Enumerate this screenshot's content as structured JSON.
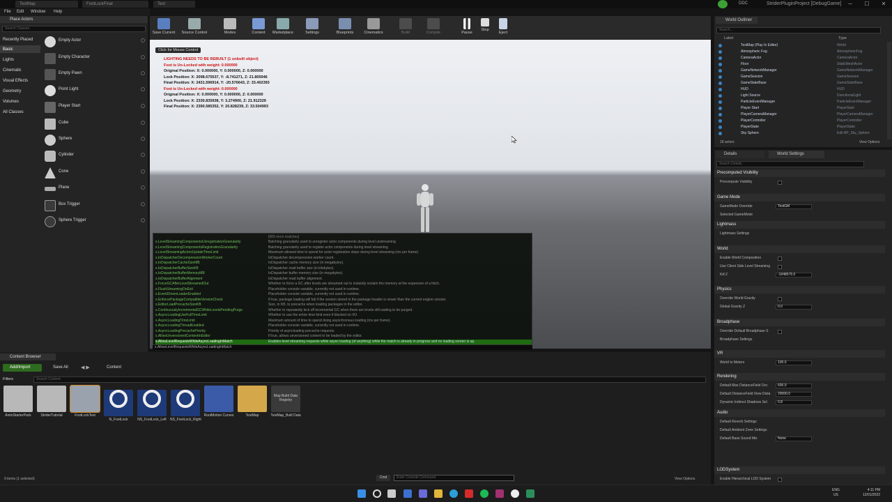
{
  "titlebar": {
    "tabs": [
      "TestMap",
      "FootLockFinal",
      "Test"
    ],
    "project": "StriderPluginProject [DebugGame]",
    "controls": [
      "─",
      "☐",
      "✕"
    ]
  },
  "menu": [
    "File",
    "Edit",
    "Window",
    "Help"
  ],
  "place_actors": {
    "tab": "Place Actors",
    "search_placeholder": "Search Classes",
    "categories": [
      "Recently Placed",
      "Basic",
      "Lights",
      "Cinematic",
      "Visual Effects",
      "Geometry",
      "Volumes",
      "All Classes"
    ],
    "items": [
      "Empty Actor",
      "Empty Character",
      "Empty Pawn",
      "Point Light",
      "Player Start",
      "Cube",
      "Sphere",
      "Cylinder",
      "Cone",
      "Plane",
      "Box Trigger",
      "Sphere Trigger"
    ]
  },
  "toolbar": [
    "Save Current",
    "Source Control",
    "Modes",
    "Content",
    "Marketplace",
    "Settings",
    "Blueprints",
    "Cinematics",
    "Build",
    "Compile",
    "Pause",
    "Stop",
    "Eject"
  ],
  "viewport": {
    "click_hint": "Click for Mouse Control",
    "lines": [
      {
        "text": "LIGHTING NEEDS TO BE REBUILT (1 unbuilt object)",
        "color": "#d01010"
      },
      {
        "text": "Foot is Un-Locked with weight: 0.000000",
        "color": "#d01010"
      },
      {
        "text": "Original Position: X: 0.000000, Y: 0.000000, Z: 0.000000",
        "color": "#111111"
      },
      {
        "text": "Lock Position: X: 2098.675537, Y: -8.741271, Z: 21.805946",
        "color": "#111111"
      },
      {
        "text": "Final Position: X: 2431.596914, Y: -20.576643, Z: 33.402393",
        "color": "#111111"
      },
      {
        "text": "Foot is Un-Locked with weight: 0.000000",
        "color": "#d01010"
      },
      {
        "text": "Original Position: X: 0.000000, Y: 0.000000, Z: 0.000000",
        "color": "#111111"
      },
      {
        "text": "Lock Position: X: 2330.835938, Y: 3.274900, Z: 21.912329",
        "color": "#111111"
      },
      {
        "text": "Final Position: X: 2390.585352, Y: 20.828239, Z: 33.504993",
        "color": "#111111"
      }
    ],
    "console": {
      "header": "[805 more matches]",
      "rows": [
        {
          "k": "s.LevelStreamingComponentsUnregistrationGranularity",
          "v": "Batching granularity used to unregister actor components during level unstreaming."
        },
        {
          "k": "s.LevelStreamingComponentsRegistrationGranularity",
          "v": "Batching granularity used to register actor components during level streaming."
        },
        {
          "k": "s.LevelStreamingActorsUpdateTimeLimit",
          "v": "Maximum allowed time to spend for actor registration steps during level streaming (ms per frame)."
        },
        {
          "k": "s.IoDispatcherDecompressionWorkerCount",
          "v": "IoDispatcher decompression worker count."
        },
        {
          "k": "s.IoDispatcherCacheSizeMB",
          "v": "IoDispatcher cache memory size (in megabytes)."
        },
        {
          "k": "s.IoDispatcherBufferSizeKB",
          "v": "IoDispatcher read buffer size (in kilobytes)."
        },
        {
          "k": "s.IoDispatcherBufferMemoryMB",
          "v": "IoDispatcher buffer memory size (in megabytes)."
        },
        {
          "k": "s.IoDispatcherBufferAlignment",
          "v": "IoDispatcher read buffer alignment."
        },
        {
          "k": "s.ForceGCAfterLevelStreamedOut",
          "v": "Whether to force a GC after levels are streamed out to instantly reclaim the memory at the expensive of a hitch."
        },
        {
          "k": "s.FlushStreamingOnExit",
          "v": "Placeholder console variable, currently not used in runtime."
        },
        {
          "k": "s.EventDrivenLoaderEnabled",
          "v": "Placeholder console variable, currently not used in runtime."
        },
        {
          "k": "s.EnforcePackageCompatibleVersionCheck",
          "v": "If true, package loading will fail if the version stored in the package header is newer than the current engine version."
        },
        {
          "k": "s.EditorLoadPrecacheSizeKB",
          "v": "Size, in KB, to precache when loading packages in the editor."
        },
        {
          "k": "s.ContinuouslyIncrementalGCWhileLevelsPendingPurge",
          "v": "Whether to repeatedly kick off incremental GC when there are levels still waiting to be purged."
        },
        {
          "k": "s.AsyncLoadingUseFullTimeLimit",
          "v": "Whether to use the entire time limit even if blocked on I/O."
        },
        {
          "k": "s.AsyncLoadingTimeLimit",
          "v": "Maximum amount of time to spend doing asynchronous loading (ms per frame)."
        },
        {
          "k": "s.AsyncLoadingThreadEnabled",
          "v": "Placeholder console variable, currently not used in runtime."
        },
        {
          "k": "s.AsyncLoadingPrecachePriority",
          "v": "Priority of asyncloading precache requests."
        },
        {
          "k": "s.AllowUnversionedContentInEditor",
          "v": "If true, allows unversioned content to be loaded by the editor."
        },
        {
          "k": "s.AllowLevelRequestsWhileAsyncLoadingInMatch",
          "v": "Enables level streaming requests while async loading (of anything) while the match is already in progress and no loading screen is up."
        }
      ],
      "input": "s.AllowLevelRequestsWhileAsyncLoadingInMatch"
    }
  },
  "content_browser": {
    "tab": "Content Browser",
    "add_import": "Add/Import",
    "save_all": "Save All",
    "path": "Content",
    "filters": "Filters",
    "search_placeholder": "Search Content",
    "assets": [
      "AnimStarterPack",
      "StriderTutorial",
      "FootLockTest",
      "N_FootLock",
      "NS_FootLock_Left",
      "NS_FootLock_Right",
      "RootMotion Curves",
      "TestMap",
      "TestMap_Built Data"
    ],
    "registry_label": "Map Build Data Registry",
    "status": "9 items (1 selected)",
    "cmd": "Cmd",
    "console_placeholder": "Enter Console Command",
    "view_options": "View Options"
  },
  "outliner": {
    "tab": "World Outliner",
    "search_placeholder": "Search...",
    "col_label": "Label",
    "col_type": "Type",
    "rows": [
      {
        "n": "TestMap (Play In Editor)",
        "t": "World"
      },
      {
        "n": "Atmospheric Fog",
        "t": "AtmosphericFog"
      },
      {
        "n": "CameraActor",
        "t": "CameraActor"
      },
      {
        "n": "Floor",
        "t": "StaticMeshActor"
      },
      {
        "n": "GameNetworkManager",
        "t": "GameNetworkManager"
      },
      {
        "n": "GameSession",
        "t": "GameSession"
      },
      {
        "n": "GameStateBase",
        "t": "GameStateBase"
      },
      {
        "n": "HUD",
        "t": "HUD"
      },
      {
        "n": "Light Source",
        "t": "DirectionalLight"
      },
      {
        "n": "ParticleEventManager",
        "t": "ParticleEventManager"
      },
      {
        "n": "Player Start",
        "t": "PlayerStart"
      },
      {
        "n": "PlayerCameraManager",
        "t": "PlayerCameraManager"
      },
      {
        "n": "PlayerController",
        "t": "PlayerController"
      },
      {
        "n": "PlayerState",
        "t": "PlayerState"
      },
      {
        "n": "Sky Sphere",
        "t": "Edit BP_Sky_Sphere"
      }
    ],
    "count": "18 actors",
    "view_options": "View Options"
  },
  "details": {
    "tabs": [
      "Details",
      "World Settings"
    ],
    "search_placeholder": "Search Details",
    "sections": [
      {
        "title": "Precomputed Visibility",
        "props": [
          {
            "n": "Precompute Visibility",
            "chk": true
          }
        ]
      },
      {
        "title": "Game Mode",
        "props": [
          {
            "n": "GameMode Override",
            "v": "TestGM"
          },
          {
            "n": "Selected GameMode",
            "v": ""
          }
        ]
      },
      {
        "title": "Lightmass",
        "props": [
          {
            "n": "Lightmass Settings",
            "v": ""
          }
        ]
      },
      {
        "title": "World",
        "props": [
          {
            "n": "Enable World Composition",
            "chk": true
          },
          {
            "n": "Use Client Side Level Streaming",
            "chk": true
          },
          {
            "n": "Kill Z",
            "v": "-1048575.0"
          }
        ]
      },
      {
        "title": "Physics",
        "props": [
          {
            "n": "Override World Gravity",
            "chk": true
          },
          {
            "n": "Global Gravity Z",
            "v": "0.0"
          }
        ]
      },
      {
        "title": "Broadphase",
        "props": [
          {
            "n": "Override Default Broadphase S",
            "chk": true
          },
          {
            "n": "Broadphase Settings",
            "v": ""
          }
        ]
      },
      {
        "title": "VR",
        "props": [
          {
            "n": "World to Meters",
            "v": "100.0"
          }
        ]
      },
      {
        "title": "Rendering",
        "props": [
          {
            "n": "Default Max DistanceField Occ",
            "v": "600.0"
          },
          {
            "n": "Default DistanceField View Dista",
            "v": "20000.0"
          },
          {
            "n": "Dynamic Indirect Shadows Sel",
            "v": "0.8"
          }
        ]
      },
      {
        "title": "Audio",
        "props": [
          {
            "n": "Default Reverb Settings",
            "v": ""
          },
          {
            "n": "Default Ambient Zone Settings",
            "v": ""
          },
          {
            "n": "Default Base Sound Mix",
            "v": "None"
          }
        ]
      },
      {
        "title": "LODSystem",
        "props": [
          {
            "n": "Enable Hierarchical LOD System",
            "chk": true
          }
        ]
      }
    ]
  },
  "taskbar": {
    "lang": "ENG",
    "region": "US",
    "time": "4:11 PM",
    "date": "12/01/2022"
  }
}
